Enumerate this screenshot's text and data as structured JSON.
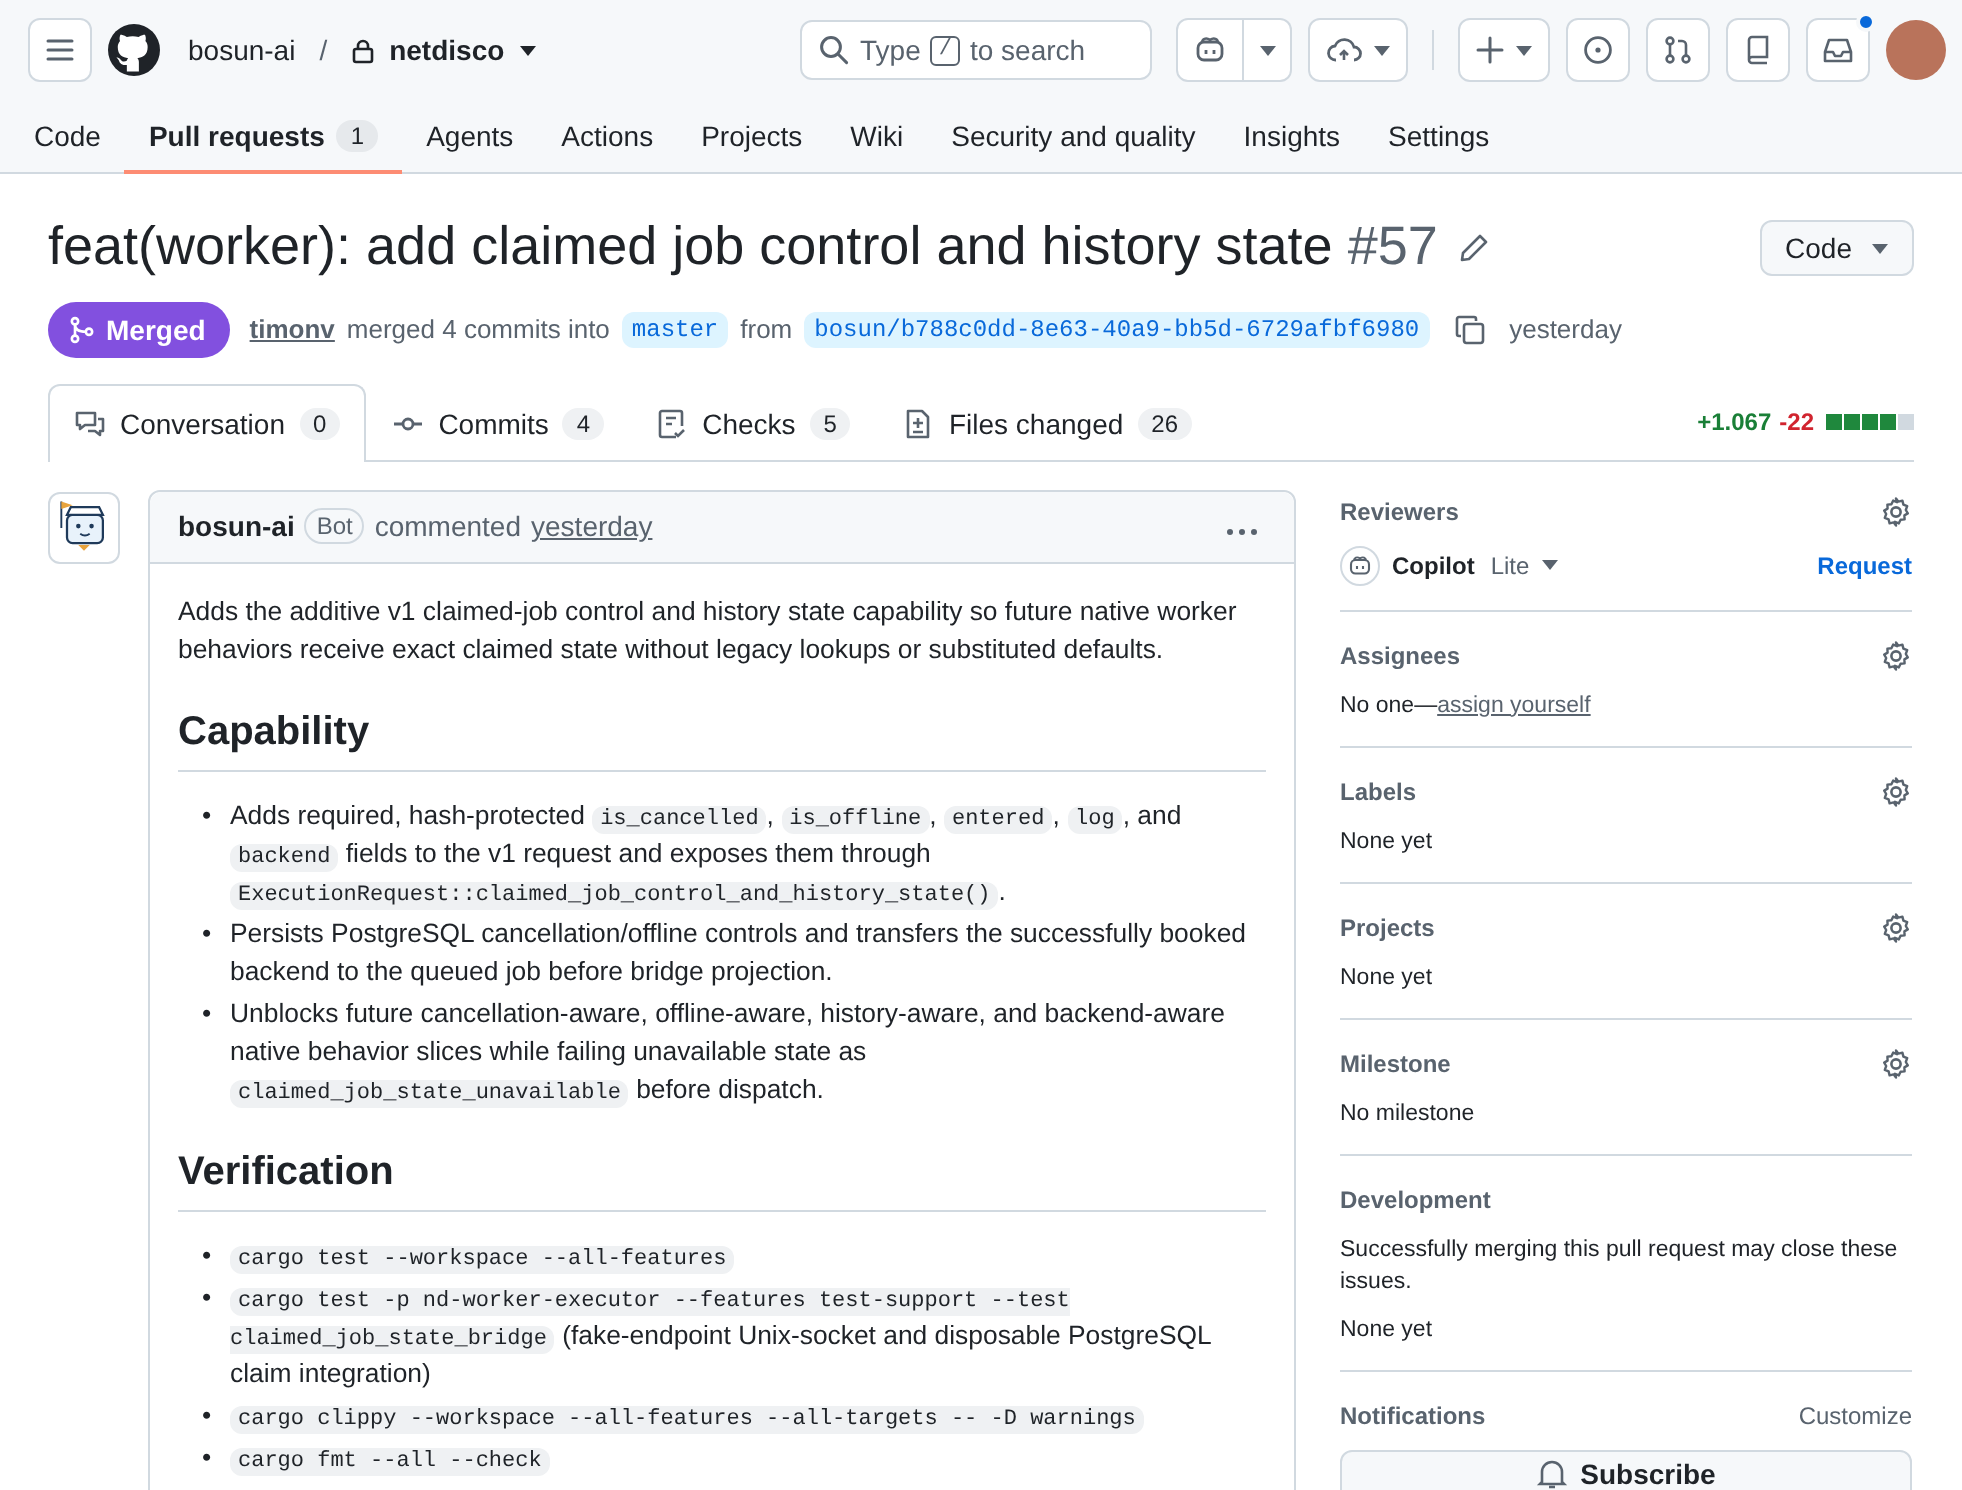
{
  "header": {
    "owner": "bosun-ai",
    "separator": "/",
    "repo": "netdisco",
    "search": {
      "prefix": "Type",
      "key": "/",
      "suffix": "to search"
    },
    "inbox_unread": true
  },
  "repo_tabs": [
    {
      "label": "Code",
      "selected": false
    },
    {
      "label": "Pull requests",
      "count": "1",
      "selected": true
    },
    {
      "label": "Agents",
      "selected": false
    },
    {
      "label": "Actions",
      "selected": false
    },
    {
      "label": "Projects",
      "selected": false
    },
    {
      "label": "Wiki",
      "selected": false
    },
    {
      "label": "Security and quality",
      "selected": false
    },
    {
      "label": "Insights",
      "selected": false
    },
    {
      "label": "Settings",
      "selected": false
    }
  ],
  "pull_request": {
    "title": "feat(worker): add claimed job control and history state",
    "number": "#57",
    "code_button": "Code",
    "status": {
      "kind": "merged",
      "label": "Merged"
    },
    "author": "timonv",
    "merge_text": "merged 4 commits into",
    "base_branch": "master",
    "from_text": "from",
    "head_branch": "bosun/b788c0dd-8e63-40a9-bb5d-6729afbf6980",
    "time": "yesterday"
  },
  "pr_tabs": [
    {
      "kind": "conversation",
      "label": "Conversation",
      "count": "0",
      "selected": true
    },
    {
      "kind": "commits",
      "label": "Commits",
      "count": "4",
      "selected": false
    },
    {
      "kind": "checks",
      "label": "Checks",
      "count": "5",
      "selected": false
    },
    {
      "kind": "files",
      "label": "Files changed",
      "count": "26",
      "selected": false
    }
  ],
  "diffstat": {
    "additions": "+1.067",
    "deletions": "-22",
    "blocks": [
      {
        "kind": "added"
      },
      {
        "kind": "added"
      },
      {
        "kind": "added"
      },
      {
        "kind": "added"
      },
      {
        "kind": "neutral"
      }
    ]
  },
  "comment": {
    "author": "bosun-ai",
    "badge": "Bot",
    "action": "commented",
    "time": "yesterday",
    "body": [
      {
        "kind": "paragraph",
        "segments": [
          {
            "kind": "text",
            "text": "Adds the additive v1 claimed-job control and history state capability so future native worker behaviors receive exact claimed state without legacy lookups or substituted defaults."
          }
        ]
      },
      {
        "kind": "heading",
        "text": "Capability"
      },
      {
        "kind": "list",
        "marker": "•",
        "items": [
          [
            {
              "kind": "text",
              "text": "Adds required, hash-protected "
            },
            {
              "kind": "code",
              "text": "is_cancelled"
            },
            {
              "kind": "text",
              "text": ", "
            },
            {
              "kind": "code",
              "text": "is_offline"
            },
            {
              "kind": "text",
              "text": ", "
            },
            {
              "kind": "code",
              "text": "entered"
            },
            {
              "kind": "text",
              "text": ", "
            },
            {
              "kind": "code",
              "text": "log"
            },
            {
              "kind": "text",
              "text": ", and "
            },
            {
              "kind": "code",
              "text": "backend"
            },
            {
              "kind": "text",
              "text": " fields to the v1 request and exposes them through "
            },
            {
              "kind": "code",
              "text": "ExecutionRequest::claimed_job_control_and_history_state()"
            },
            {
              "kind": "text",
              "text": "."
            }
          ],
          [
            {
              "kind": "text",
              "text": "Persists PostgreSQL cancellation/offline controls and transfers the successfully booked backend to the queued job before bridge projection."
            }
          ],
          [
            {
              "kind": "text",
              "text": "Unblocks future cancellation-aware, offline-aware, history-aware, and backend-aware native behavior slices while failing unavailable state as "
            },
            {
              "kind": "code",
              "text": "claimed_job_state_unavailable"
            },
            {
              "kind": "text",
              "text": " before dispatch."
            }
          ]
        ]
      },
      {
        "kind": "heading",
        "text": "Verification"
      },
      {
        "kind": "list",
        "marker": "•",
        "items": [
          [
            {
              "kind": "code",
              "text": "cargo test --workspace --all-features"
            }
          ],
          [
            {
              "kind": "code",
              "text": "cargo test -p nd-worker-executor --features test-support --test claimed_job_state_bridge"
            },
            {
              "kind": "text",
              "text": " (fake-endpoint Unix-socket and disposable PostgreSQL claim integration)"
            }
          ],
          [
            {
              "kind": "code",
              "text": "cargo clippy --workspace --all-features --all-targets -- -D warnings"
            }
          ],
          [
            {
              "kind": "code",
              "text": "cargo fmt --all --check"
            }
          ]
        ]
      }
    ]
  },
  "sidebar": [
    {
      "heading": "Reviewers",
      "settings": true,
      "items": [
        {
          "kind": "reviewer",
          "name": "Copilot",
          "tag": "Lite",
          "action": "Request"
        }
      ]
    },
    {
      "heading": "Assignees",
      "settings": true,
      "items": [
        {
          "kind": "text_link",
          "text": "No one—",
          "link": "assign yourself"
        }
      ]
    },
    {
      "heading": "Labels",
      "settings": true,
      "items": [
        {
          "kind": "text",
          "text": "None yet"
        }
      ]
    },
    {
      "heading": "Projects",
      "settings": true,
      "items": [
        {
          "kind": "text",
          "text": "None yet"
        }
      ]
    },
    {
      "heading": "Milestone",
      "settings": true,
      "items": [
        {
          "kind": "text",
          "text": "No milestone"
        }
      ]
    },
    {
      "heading": "Development",
      "settings": false,
      "items": [
        {
          "kind": "text",
          "text": "Successfully merging this pull request may close these issues."
        },
        {
          "kind": "text",
          "text": "None yet"
        }
      ]
    },
    {
      "heading": "Notifications",
      "settings": false,
      "action": "Customize",
      "items": [
        {
          "kind": "button",
          "label": "Subscribe"
        }
      ]
    }
  ]
}
